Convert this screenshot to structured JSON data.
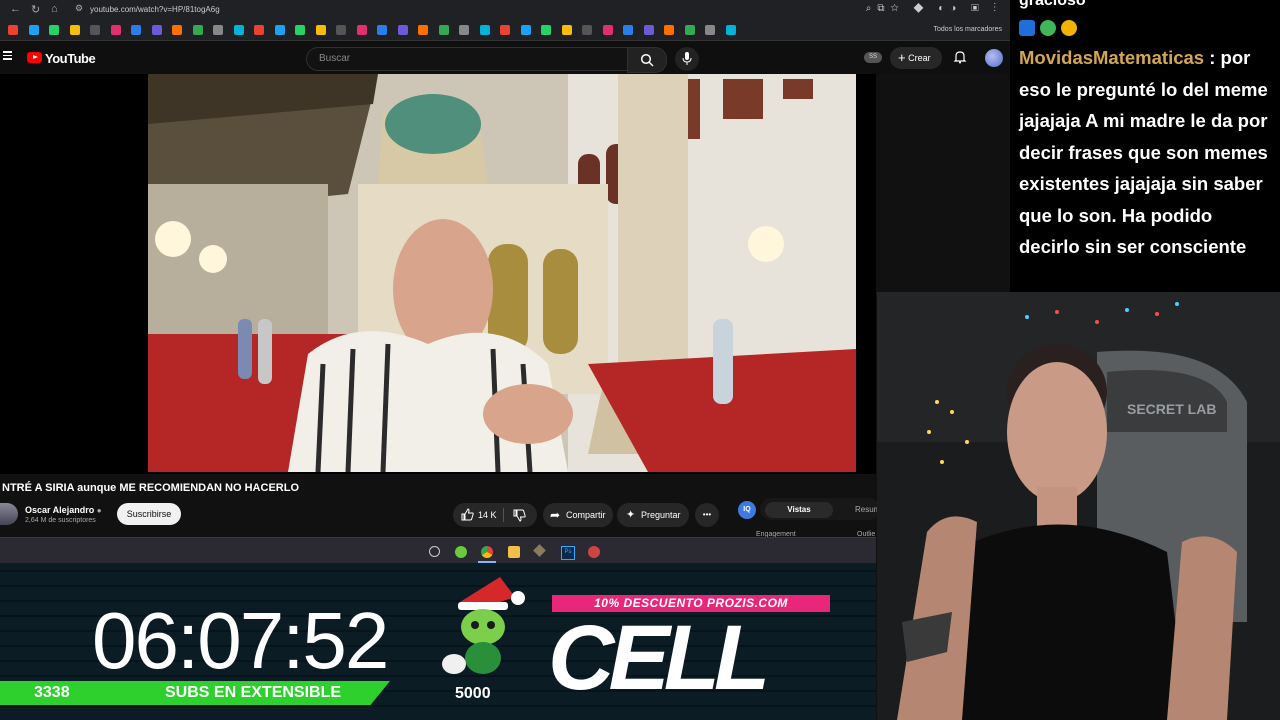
{
  "browser": {
    "url": "youtube.com/watch?v=HP/81togA6g",
    "bookmarks_all_label": "Todos los marcadores"
  },
  "youtube": {
    "brand": "YouTube",
    "search_placeholder": "Buscar",
    "ss_badge": "SS",
    "create_label": "Crear"
  },
  "video": {
    "title": "NTRÉ A SIRIA aunque ME RECOMIENDAN NO HACERLO",
    "channel_name": "Oscar Alejandro",
    "channel_subs": "2,64 M de suscriptores",
    "subscribe_label": "Suscribirse",
    "like_count": "14 K",
    "share_label": "Compartir",
    "ask_label": "Preguntar",
    "more_label": "•••"
  },
  "extension": {
    "badge": "IQ",
    "tab_views": "Vistas",
    "tab_summary": "Resum",
    "engagement_label": "Engagement",
    "outlier_label": "Outlie"
  },
  "overlay": {
    "timer": "06:07:52",
    "subs_count": "3338",
    "subs_label": "SUBS EN EXTENSIBLE",
    "goal": "5000",
    "promo": "10% DESCUENTO PROZIS.COM",
    "logo_text": "CELL"
  },
  "chat": {
    "previous_fragment": "gracioso",
    "username": "MovidasMatematicas",
    "message": " : por eso le pregunté lo del meme jajajaja A mi madre le da por decir frases que son memes existentes jajajaja sin saber que lo son. Ha podido decirlo sin ser consciente"
  },
  "webcam": {
    "chair_brand": "SECRET LAB"
  },
  "colors": {
    "youtube_red": "#ff0000",
    "subs_green": "#2dd02d",
    "promo_pink": "#e8267a",
    "chat_username": "#d4a654"
  }
}
